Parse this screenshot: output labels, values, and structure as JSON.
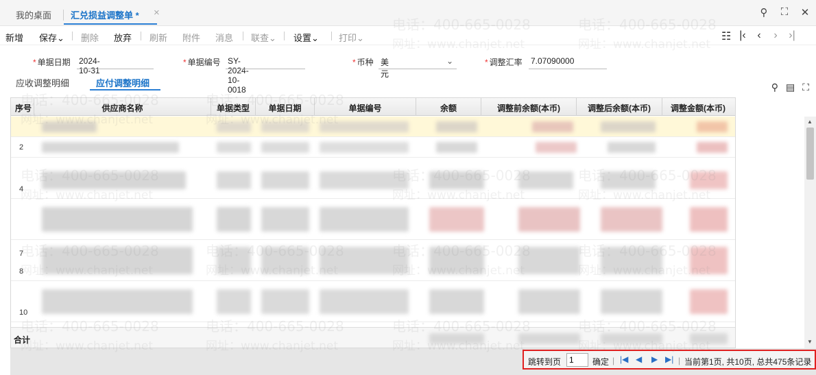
{
  "tabs": {
    "home_label": "我的桌面",
    "active_label": "汇兑损益调整单 *",
    "close_glyph": "×"
  },
  "window_icons": [
    "search-icon",
    "maximize-icon",
    "close-icon"
  ],
  "toolbar": {
    "new": "新增",
    "save": "保存",
    "delete": "删除",
    "discard": "放弃",
    "refresh": "刷新",
    "attachment": "附件",
    "message": "消息",
    "linked_query": "联查",
    "settings": "设置",
    "print": "打印",
    "dropdown_glyph": "⌄"
  },
  "form": {
    "date_label": "单据日期",
    "date_value": "2024-10-31",
    "code_label": "单据编号",
    "code_value": "SY-2024-10-0018",
    "currency_label": "币种",
    "currency_value": "美元",
    "rate_label": "调整汇率",
    "rate_value": "7.07090000"
  },
  "subtabs": {
    "receivable": "应收调整明细",
    "payable": "应付调整明细"
  },
  "grid": {
    "columns": [
      "序号",
      "供应商名称",
      "单据类型",
      "单据日期",
      "单据编号",
      "余额",
      "调整前余额(本币)",
      "调整后余额(本币)",
      "调整金额(本币)"
    ],
    "row_numbers": [
      "2",
      "4",
      "7",
      "8",
      "10"
    ],
    "total_label": "合计"
  },
  "pager": {
    "jump_label": "跳转到页",
    "page_input": "1",
    "confirm_label": "确定",
    "status": "当前第1页, 共10页, 总共475条记录"
  },
  "watermark": {
    "phone": "电话：400-665-0028",
    "site": "网址：www.chanjet.net"
  },
  "colors": {
    "accent": "#1a73c8",
    "highlight_box": "#e02020",
    "selected_row": "#fff8d8"
  }
}
